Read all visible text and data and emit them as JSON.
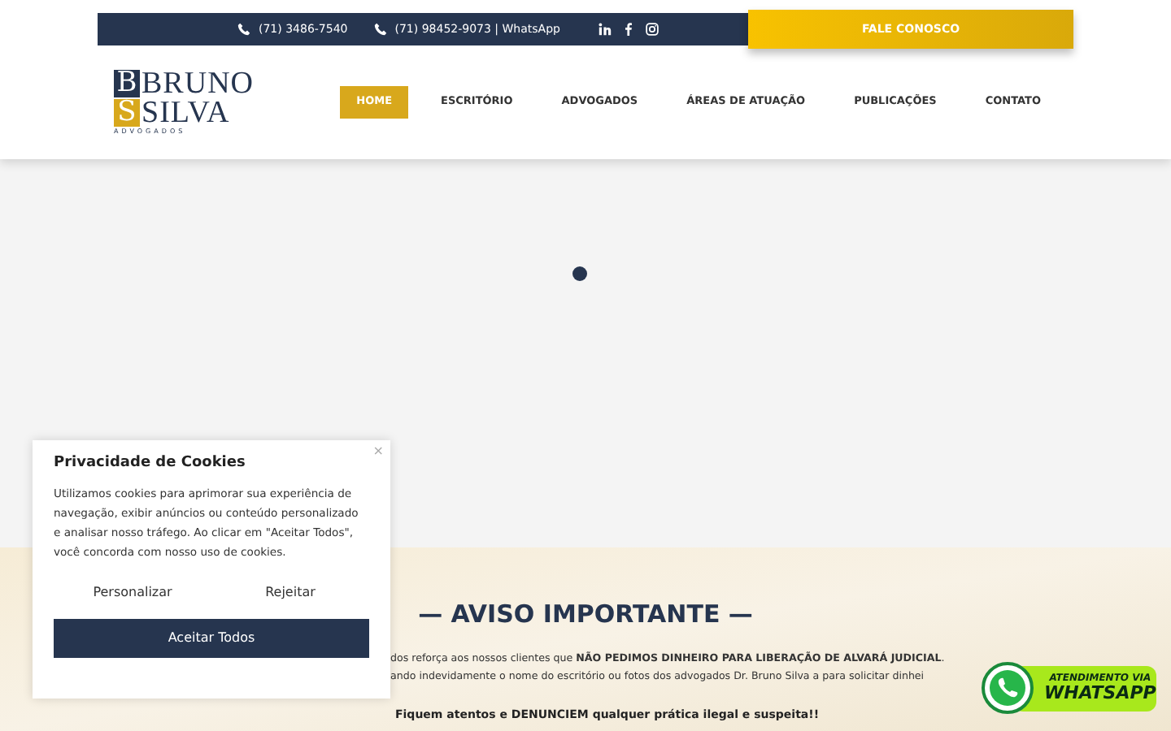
{
  "top_bar": {
    "phones": [
      "(71) 3486-7540",
      "(71) 98452-9073 | WhatsApp"
    ],
    "cta": "FALE CONOSCO"
  },
  "logo": {
    "letters": [
      "B",
      "S"
    ],
    "words": [
      "BRUNO",
      "SILVA"
    ],
    "tagline": "ADVOGADOS"
  },
  "nav": [
    {
      "label": "HOME",
      "selected": true
    },
    {
      "label": "ESCRITÓRIO",
      "selected": false
    },
    {
      "label": "ADVOGADOS",
      "selected": false
    },
    {
      "label": "ÁREAS DE ATUAÇÃO",
      "selected": false
    },
    {
      "label": "PUBLICAÇÕES",
      "selected": false
    },
    {
      "label": "CONTATO",
      "selected": false
    }
  ],
  "notice": {
    "title": "— AVISO IMPORTANTE —",
    "lines": [
      "dos reforça aos nossos clientes que **NÃO PEDIMOS DINHEIRO PARA LIBERAÇÃO DE ALVARÁ JUDICIAL**.",
      "ando indevidamente o nome do escritório ou fotos dos advogados Dr. Bruno Silva a para solicitar dinhei"
    ],
    "warning": "Fiquem atentos e DENUNCIEM qualquer prática ilegal e suspeita!!"
  },
  "cookie_popup": {
    "close": "×",
    "title": "Privacidade de Cookies",
    "text": "Utilizamos cookies para aprimorar sua experiência de navegação, exibir anúncios ou conteúdo personalizado e analisar nosso tráfego. Ao clicar em \"Aceitar Todos\", você concorda com nosso uso de cookies.",
    "buttons": [
      "Personalizar",
      "Rejeitar"
    ],
    "accept": "Aceitar Todos"
  },
  "whatsapp_badge": {
    "lines": [
      "ATENDIMENTO VIA",
      "WHATSAPP"
    ]
  }
}
